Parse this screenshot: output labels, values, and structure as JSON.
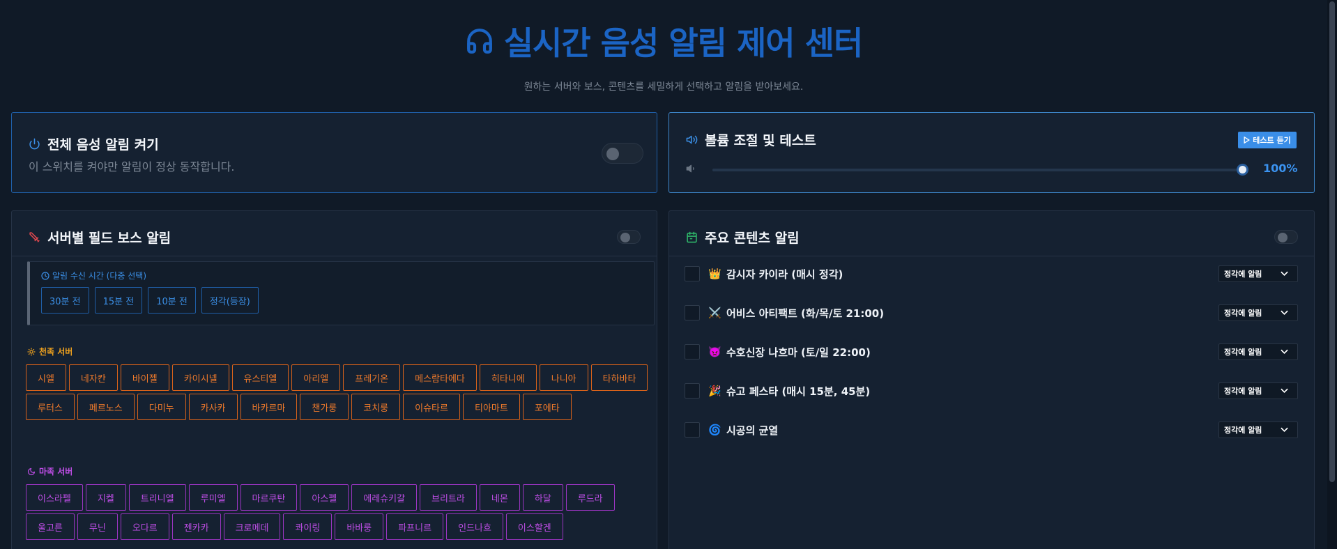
{
  "header": {
    "title": "실시간 음성 알림 제어 센터",
    "subtitle": "원하는 서버와 보스, 콘텐츠를 세밀하게 선택하고 알림을 받아보세요."
  },
  "master": {
    "title": "전체 음성 알림 켜기",
    "desc": "이 스위치를 켜야만 알림이 정상 동작합니다."
  },
  "volume": {
    "title": "볼륨 조절 및 테스트",
    "test_label": "테스트 듣기",
    "value": 100,
    "value_label": "100%"
  },
  "field_boss": {
    "title": "서버별 필드 보스 알림",
    "time_label": "알림 수신 시간 (다중 선택)",
    "time_options": [
      "30분 전",
      "15분 전",
      "10분 전",
      "정각(등장)"
    ],
    "sky_label": "천족 서버",
    "sky_servers": [
      "시엘",
      "네자칸",
      "바이젤",
      "카이시넬",
      "유스티엘",
      "아리엘",
      "프레기온",
      "메스람타에다",
      "히타니에",
      "나니아",
      "타하바타",
      "루터스",
      "페르노스",
      "다미누",
      "카사카",
      "바카르마",
      "챈가룽",
      "코치룽",
      "이슈타르",
      "티아마트",
      "포에타"
    ],
    "demon_label": "마족 서버",
    "demon_servers": [
      "이스라펠",
      "지켈",
      "트리니엘",
      "루미엘",
      "마르쿠탄",
      "아스펠",
      "에레슈키갈",
      "브리트라",
      "네몬",
      "하달",
      "루드라",
      "울고른",
      "무닌",
      "오다르",
      "젠카카",
      "크로메데",
      "콰이링",
      "바바룽",
      "파프니르",
      "인드나흐",
      "이스할겐"
    ],
    "colors": {
      "sky": "#f07a2b",
      "demon": "#c04ee8"
    }
  },
  "contents": {
    "title": "주요 콘텐츠 알림",
    "items": [
      {
        "emoji": "👑",
        "name": "감시자 카이라 (매시 정각)",
        "option": "정각에 알림"
      },
      {
        "emoji": "⚔️",
        "name": "어비스 아티팩트 (화/목/토 21:00)",
        "option": "정각에 알림"
      },
      {
        "emoji": "👿",
        "name": "수호신장 나흐마 (토/일 22:00)",
        "option": "정각에 알림"
      },
      {
        "emoji": "🎉",
        "name": "슈고 페스타 (매시 15분, 45분)",
        "option": "정각에 알림"
      },
      {
        "emoji": "🌀",
        "name": "시공의 균열",
        "option": "정각에 알림"
      }
    ]
  },
  "colors": {
    "accent": "#3b8fe6",
    "title_blue": "#1b64c4",
    "bg": "#101a27"
  }
}
